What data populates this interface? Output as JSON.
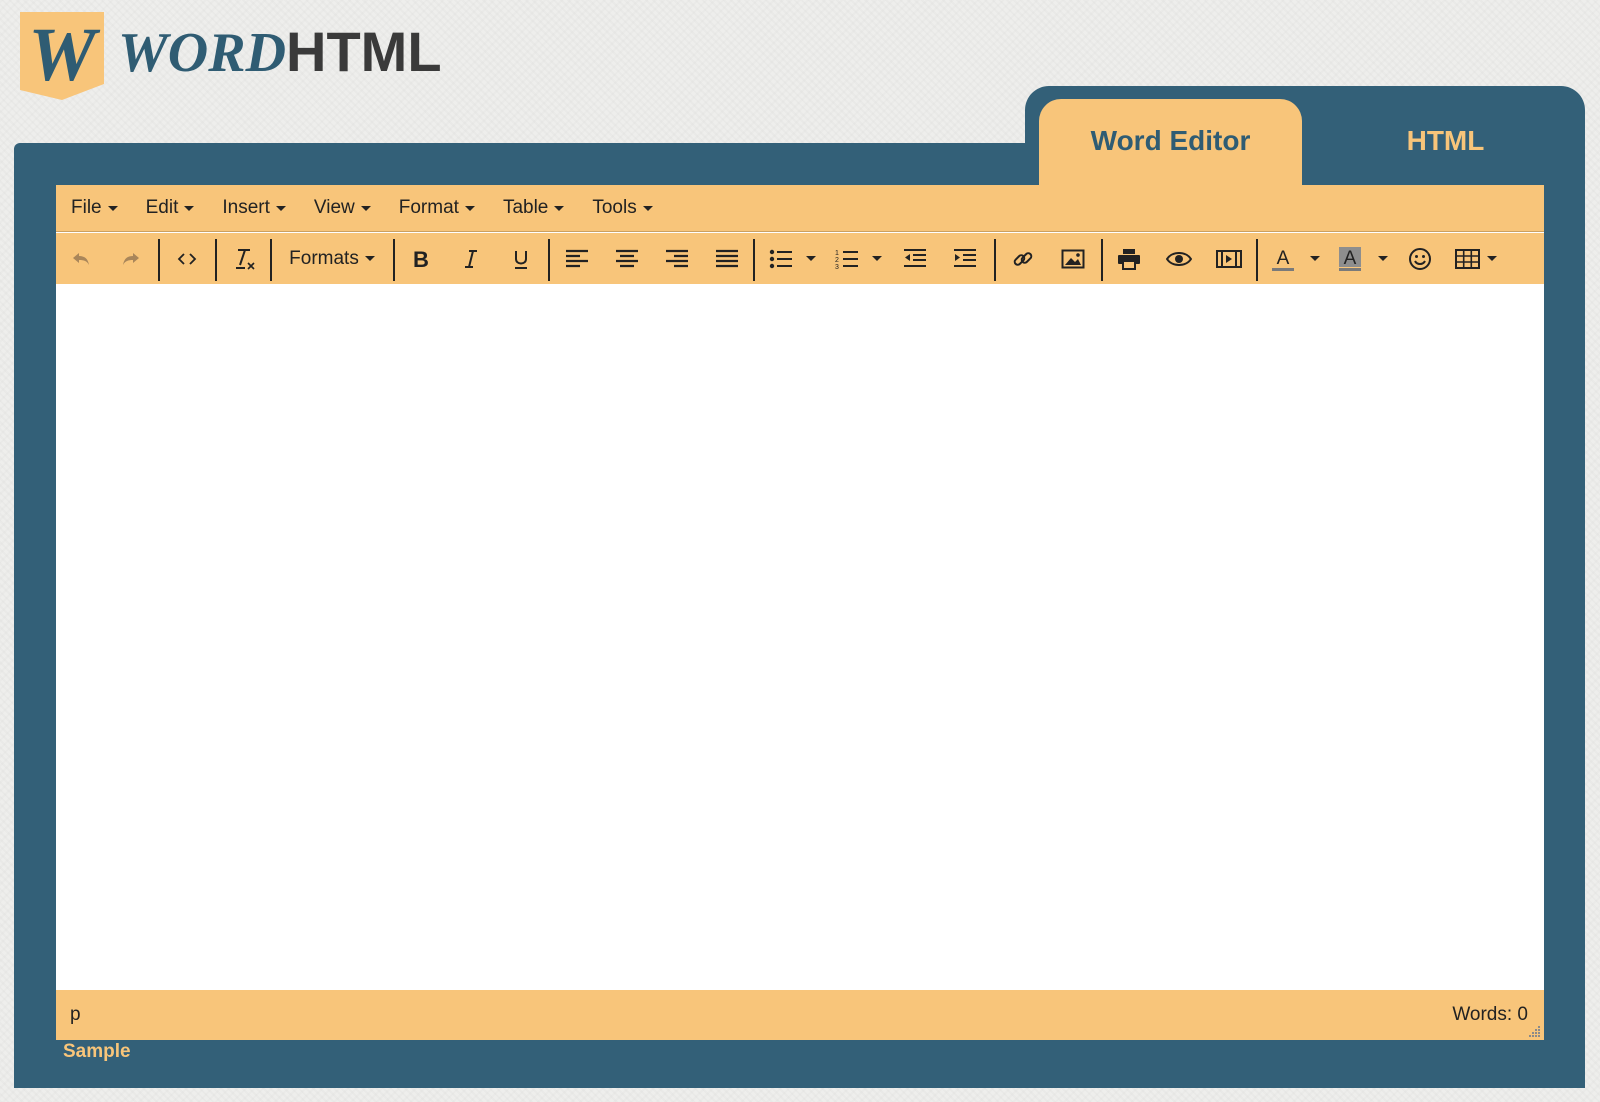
{
  "logo": {
    "badge_letter": "W",
    "word": "WORD",
    "html": "HTML"
  },
  "tabs": [
    {
      "label": "Word Editor",
      "active": true
    },
    {
      "label": "HTML",
      "active": false
    }
  ],
  "menubar": [
    "File",
    "Edit",
    "Insert",
    "View",
    "Format",
    "Table",
    "Tools"
  ],
  "toolbar": {
    "formats_label": "Formats",
    "icons": [
      "undo-icon",
      "redo-icon",
      "source-code-icon",
      "clear-formatting-icon",
      "bold-icon",
      "italic-icon",
      "underline-icon",
      "align-left-icon",
      "align-center-icon",
      "align-right-icon",
      "justify-icon",
      "bullet-list-icon",
      "numbered-list-icon",
      "outdent-icon",
      "indent-icon",
      "link-icon",
      "image-icon",
      "print-icon",
      "preview-icon",
      "media-icon",
      "text-color-icon",
      "background-color-icon",
      "emoticons-icon",
      "table-icon"
    ]
  },
  "statusbar": {
    "path": "p",
    "words": "Words: 0"
  },
  "sample_link": "Sample",
  "colors": {
    "frame": "#336078",
    "accent": "#f8c57a",
    "text": "#222222"
  }
}
